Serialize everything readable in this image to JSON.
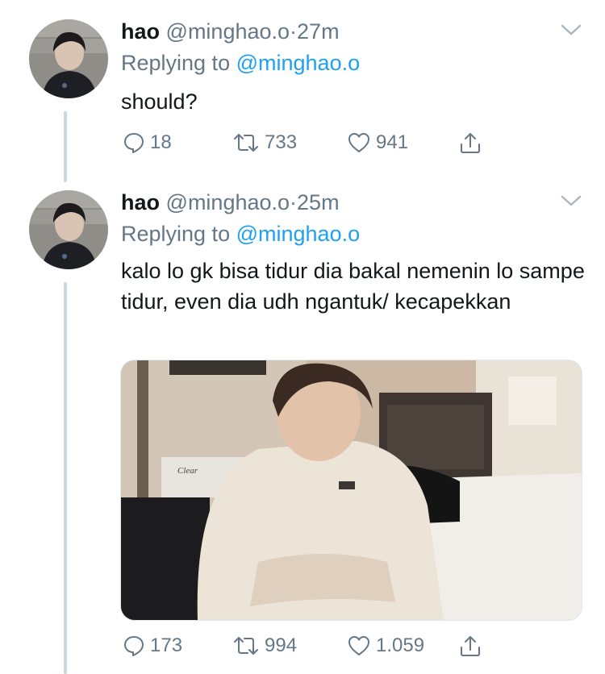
{
  "tweets": [
    {
      "name": "hao",
      "handle": "@minghao.o",
      "separator": "·",
      "time": "27m",
      "replying_label": "Replying to",
      "replying_to": "@minghao.o",
      "text": "should?",
      "replies": "18",
      "retweets": "733",
      "likes": "941"
    },
    {
      "name": "hao",
      "handle": "@minghao.o",
      "separator": "·",
      "time": "25m",
      "replying_label": "Replying to",
      "replying_to": "@minghao.o",
      "text": "kalo lo gk bisa tidur dia bakal nemenin lo sampe tidur, even dia udh ngantuk/ kecapekkan",
      "media_text": "Clear",
      "replies": "173",
      "retweets": "994",
      "likes": "1.059"
    }
  ],
  "icons": {
    "reply": "reply-icon",
    "retweet": "retweet-icon",
    "like": "heart-icon",
    "share": "share-icon",
    "menu": "chevron-down-icon"
  },
  "colors": {
    "text": "#14171a",
    "secondary": "#657786",
    "link": "#1da1f2",
    "thread_line": "#ccd6dd"
  }
}
